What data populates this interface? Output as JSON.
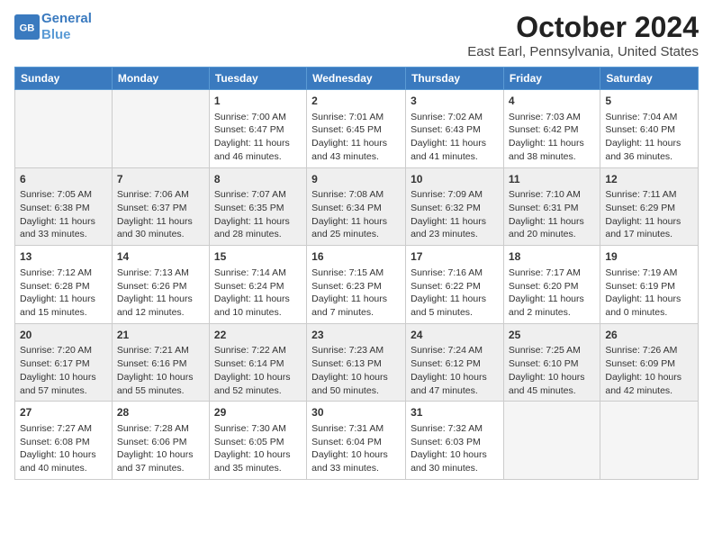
{
  "logo": {
    "line1": "General",
    "line2": "Blue"
  },
  "title": "October 2024",
  "subtitle": "East Earl, Pennsylvania, United States",
  "days_of_week": [
    "Sunday",
    "Monday",
    "Tuesday",
    "Wednesday",
    "Thursday",
    "Friday",
    "Saturday"
  ],
  "weeks": [
    [
      {
        "day": "",
        "content": ""
      },
      {
        "day": "",
        "content": ""
      },
      {
        "day": "1",
        "content": "Sunrise: 7:00 AM\nSunset: 6:47 PM\nDaylight: 11 hours\nand 46 minutes."
      },
      {
        "day": "2",
        "content": "Sunrise: 7:01 AM\nSunset: 6:45 PM\nDaylight: 11 hours\nand 43 minutes."
      },
      {
        "day": "3",
        "content": "Sunrise: 7:02 AM\nSunset: 6:43 PM\nDaylight: 11 hours\nand 41 minutes."
      },
      {
        "day": "4",
        "content": "Sunrise: 7:03 AM\nSunset: 6:42 PM\nDaylight: 11 hours\nand 38 minutes."
      },
      {
        "day": "5",
        "content": "Sunrise: 7:04 AM\nSunset: 6:40 PM\nDaylight: 11 hours\nand 36 minutes."
      }
    ],
    [
      {
        "day": "6",
        "content": "Sunrise: 7:05 AM\nSunset: 6:38 PM\nDaylight: 11 hours\nand 33 minutes."
      },
      {
        "day": "7",
        "content": "Sunrise: 7:06 AM\nSunset: 6:37 PM\nDaylight: 11 hours\nand 30 minutes."
      },
      {
        "day": "8",
        "content": "Sunrise: 7:07 AM\nSunset: 6:35 PM\nDaylight: 11 hours\nand 28 minutes."
      },
      {
        "day": "9",
        "content": "Sunrise: 7:08 AM\nSunset: 6:34 PM\nDaylight: 11 hours\nand 25 minutes."
      },
      {
        "day": "10",
        "content": "Sunrise: 7:09 AM\nSunset: 6:32 PM\nDaylight: 11 hours\nand 23 minutes."
      },
      {
        "day": "11",
        "content": "Sunrise: 7:10 AM\nSunset: 6:31 PM\nDaylight: 11 hours\nand 20 minutes."
      },
      {
        "day": "12",
        "content": "Sunrise: 7:11 AM\nSunset: 6:29 PM\nDaylight: 11 hours\nand 17 minutes."
      }
    ],
    [
      {
        "day": "13",
        "content": "Sunrise: 7:12 AM\nSunset: 6:28 PM\nDaylight: 11 hours\nand 15 minutes."
      },
      {
        "day": "14",
        "content": "Sunrise: 7:13 AM\nSunset: 6:26 PM\nDaylight: 11 hours\nand 12 minutes."
      },
      {
        "day": "15",
        "content": "Sunrise: 7:14 AM\nSunset: 6:24 PM\nDaylight: 11 hours\nand 10 minutes."
      },
      {
        "day": "16",
        "content": "Sunrise: 7:15 AM\nSunset: 6:23 PM\nDaylight: 11 hours\nand 7 minutes."
      },
      {
        "day": "17",
        "content": "Sunrise: 7:16 AM\nSunset: 6:22 PM\nDaylight: 11 hours\nand 5 minutes."
      },
      {
        "day": "18",
        "content": "Sunrise: 7:17 AM\nSunset: 6:20 PM\nDaylight: 11 hours\nand 2 minutes."
      },
      {
        "day": "19",
        "content": "Sunrise: 7:19 AM\nSunset: 6:19 PM\nDaylight: 11 hours\nand 0 minutes."
      }
    ],
    [
      {
        "day": "20",
        "content": "Sunrise: 7:20 AM\nSunset: 6:17 PM\nDaylight: 10 hours\nand 57 minutes."
      },
      {
        "day": "21",
        "content": "Sunrise: 7:21 AM\nSunset: 6:16 PM\nDaylight: 10 hours\nand 55 minutes."
      },
      {
        "day": "22",
        "content": "Sunrise: 7:22 AM\nSunset: 6:14 PM\nDaylight: 10 hours\nand 52 minutes."
      },
      {
        "day": "23",
        "content": "Sunrise: 7:23 AM\nSunset: 6:13 PM\nDaylight: 10 hours\nand 50 minutes."
      },
      {
        "day": "24",
        "content": "Sunrise: 7:24 AM\nSunset: 6:12 PM\nDaylight: 10 hours\nand 47 minutes."
      },
      {
        "day": "25",
        "content": "Sunrise: 7:25 AM\nSunset: 6:10 PM\nDaylight: 10 hours\nand 45 minutes."
      },
      {
        "day": "26",
        "content": "Sunrise: 7:26 AM\nSunset: 6:09 PM\nDaylight: 10 hours\nand 42 minutes."
      }
    ],
    [
      {
        "day": "27",
        "content": "Sunrise: 7:27 AM\nSunset: 6:08 PM\nDaylight: 10 hours\nand 40 minutes."
      },
      {
        "day": "28",
        "content": "Sunrise: 7:28 AM\nSunset: 6:06 PM\nDaylight: 10 hours\nand 37 minutes."
      },
      {
        "day": "29",
        "content": "Sunrise: 7:30 AM\nSunset: 6:05 PM\nDaylight: 10 hours\nand 35 minutes."
      },
      {
        "day": "30",
        "content": "Sunrise: 7:31 AM\nSunset: 6:04 PM\nDaylight: 10 hours\nand 33 minutes."
      },
      {
        "day": "31",
        "content": "Sunrise: 7:32 AM\nSunset: 6:03 PM\nDaylight: 10 hours\nand 30 minutes."
      },
      {
        "day": "",
        "content": ""
      },
      {
        "day": "",
        "content": ""
      }
    ]
  ]
}
